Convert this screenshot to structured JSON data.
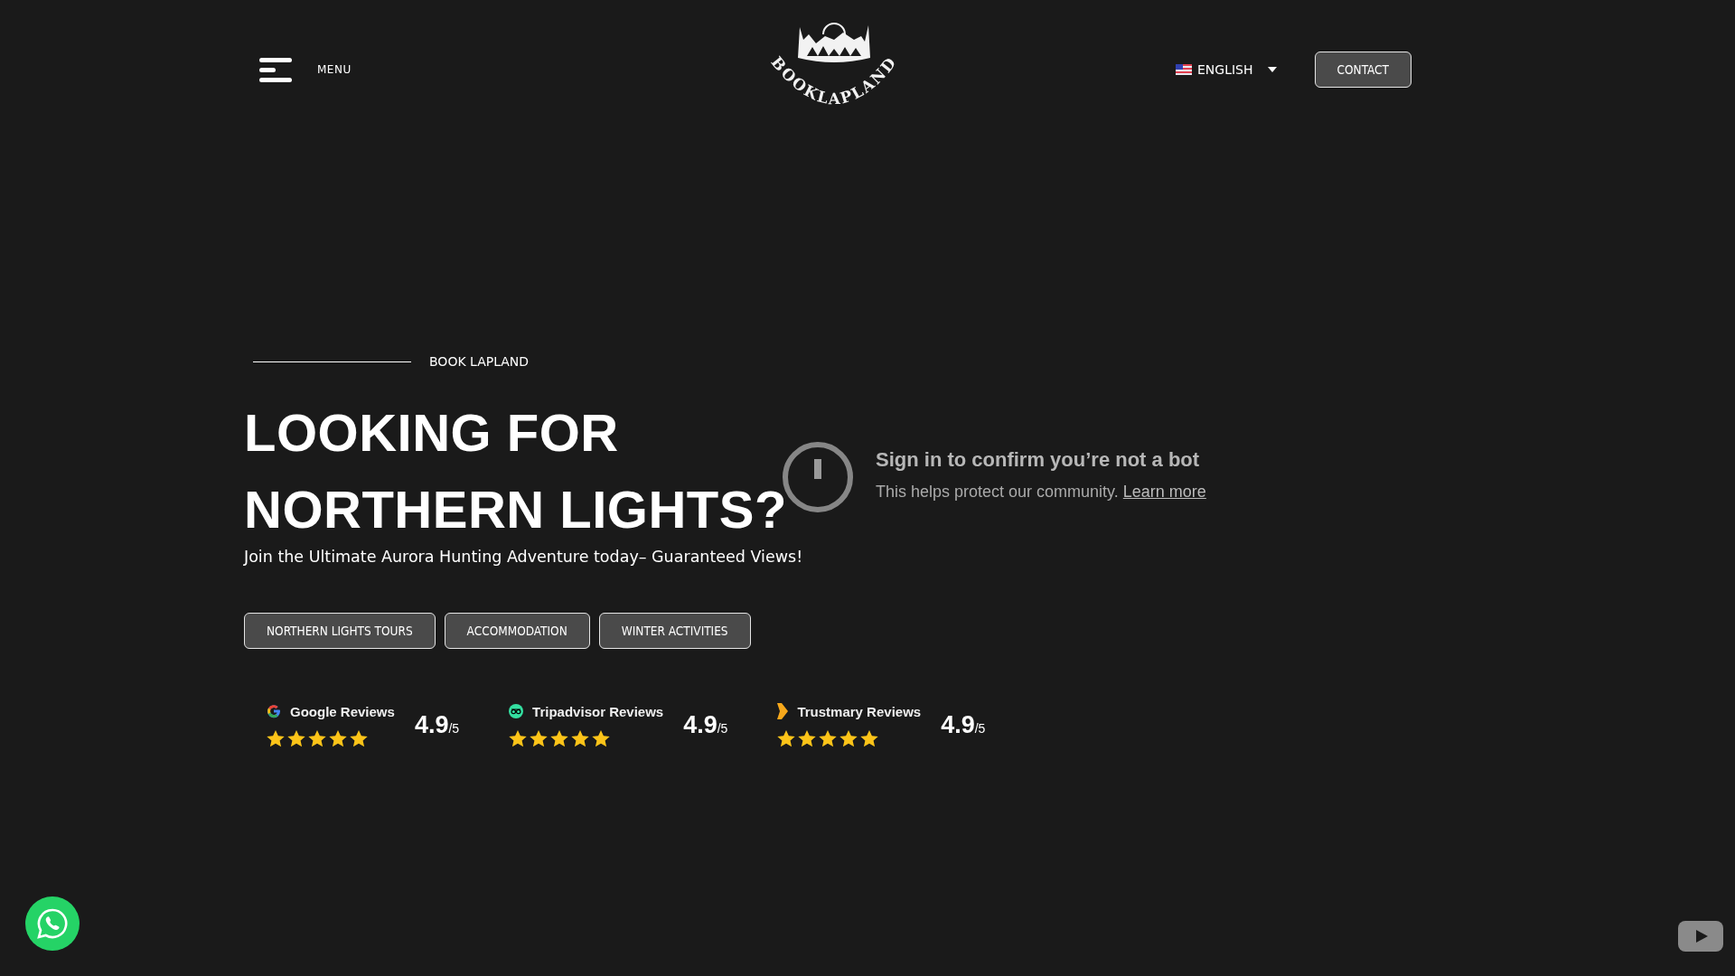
{
  "header": {
    "menu_label": "MENU",
    "logo_text": "BOOKLAPLAND",
    "language": "ENGLISH",
    "contact_button": "CONTACT"
  },
  "hero": {
    "eyebrow": "BOOK LAPLAND",
    "heading_lines": [
      "LOOKING FOR",
      "NORTHERN LIGHTS?"
    ],
    "subtitle": "Join the Ultimate Aurora Hunting Adventure today– Guaranteed Views!",
    "buttons": [
      "NORTHERN LIGHTS TOURS",
      "ACCOMMODATION",
      "WINTER ACTIVITIES"
    ]
  },
  "reviews": [
    {
      "kind": "google",
      "label": "Google Reviews",
      "stars": 5,
      "score": "4.9",
      "scale": "/5"
    },
    {
      "kind": "tripadvisor",
      "label": "Tripadvisor Reviews",
      "stars": 5,
      "score": "4.9",
      "scale": "/5"
    },
    {
      "kind": "trustmary",
      "label": "Trustmary Reviews",
      "stars": 5,
      "score": "4.9",
      "scale": "/5"
    }
  ],
  "video_notice": {
    "title": "Sign in to confirm you’re not a bot",
    "text": "This helps protect our community.",
    "link": "Learn more"
  }
}
